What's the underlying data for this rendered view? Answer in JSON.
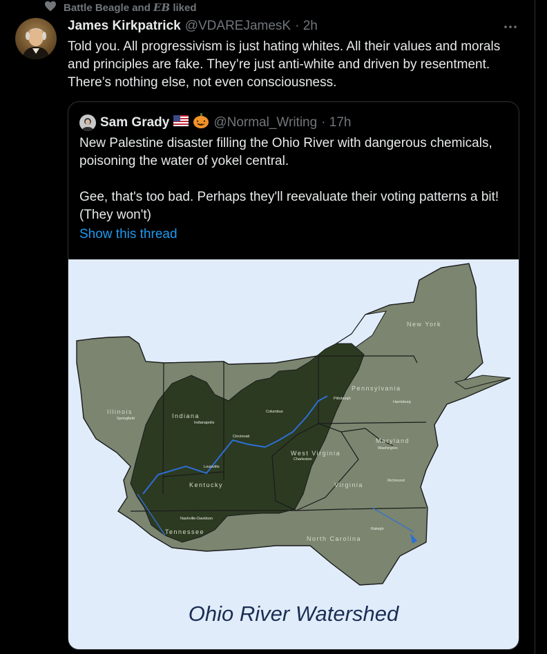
{
  "social_context": {
    "text": "Battle Beagle and",
    "eb": "EB",
    "suffix": "liked"
  },
  "tweet": {
    "name": "James Kirkpatrick",
    "handle": "@VDAREJamesK",
    "time": "· 2h",
    "text": "Told you. All progressivism is just hating whites. All their values and morals and principles are fake. They’re just anti-white and driven by resentment. There’s nothing else, not even consciousness."
  },
  "quote": {
    "name": "Sam Grady",
    "flag": "🇺🇸",
    "pumpkin": "🎃",
    "handle": "@Normal_Writing",
    "time": "· 17h",
    "paragraph1": "New Palestine disaster filling the Ohio River with dangerous chemicals, poisoning the water of yokel central.",
    "paragraph2": "Gee, that's too bad. Perhaps they'll reevaluate their voting patterns a bit! (They won't)",
    "show_thread": "Show this thread",
    "map": {
      "title": "Ohio River Watershed",
      "labels": {
        "new_york": "New York",
        "pennsylvania": "Pennsylvania",
        "illinois": "Illinois",
        "indiana": "Indiana",
        "ohio_city": "Columbus",
        "west_virginia": "West Virginia",
        "virginia": "Virginia",
        "north_carolina": "North Carolina",
        "kentucky": "Kentucky",
        "tennessee": "Tennessee",
        "maryland": "Maryland",
        "indianapolis": "Indianapolis",
        "cincinnati": "Cincinnati",
        "louisville": "Louisville",
        "pittsburgh": "Pittsburgh",
        "charleston": "Charleston",
        "nashville": "Nashville-Davidson",
        "springfield": "Springfield",
        "harrisburg": "Harrisburg",
        "washington": "Washington",
        "richmond": "Richmond",
        "raleigh": "Raleigh"
      }
    }
  },
  "colors": {
    "background": "#000000",
    "text": "#e7e9ea",
    "muted": "#71767b",
    "link": "#1d9bf0",
    "map_sea": "#e0ecfa",
    "map_land": "#7b8570",
    "map_watershed": "#2c3a22",
    "river": "#2d6fd6"
  },
  "icons": [
    "heart-icon",
    "more-icon",
    "avatar",
    "us-flag",
    "pumpkin"
  ]
}
